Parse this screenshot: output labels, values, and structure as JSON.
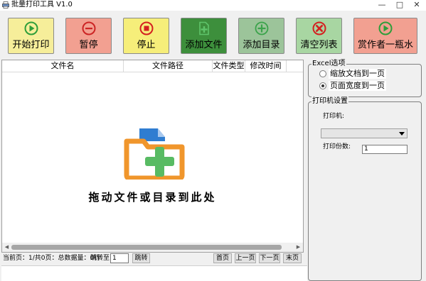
{
  "window": {
    "title": "批量打印工具 V1.0",
    "minimize_glyph": "—",
    "maximize_glyph": "□",
    "close_glyph": "✕"
  },
  "toolbar": {
    "buttons": [
      {
        "id": "start",
        "label": "开始打印",
        "icon": "play-circle-icon",
        "bg": "#f6ee9a",
        "icon_color": "#2e9e3a"
      },
      {
        "id": "pause",
        "label": "暂停",
        "icon": "minus-circle-icon",
        "bg": "#f2a091",
        "icon_color": "#cc2424"
      },
      {
        "id": "stop",
        "label": "停止",
        "icon": "stop-circle-icon",
        "bg": "#f6ee7a",
        "icon_color": "#d42020"
      },
      {
        "id": "addfile",
        "label": "添加文件",
        "icon": "add-file-icon",
        "bg": "#3d8f3c",
        "icon_color": "#5fc46a"
      },
      {
        "id": "adddir",
        "label": "添加目录",
        "icon": "add-folder-icon",
        "bg": "#9cc49a",
        "icon_color": "#3aa34a"
      },
      {
        "id": "clear",
        "label": "清空列表",
        "icon": "clear-x-icon",
        "bg": "#a8d6a2",
        "icon_color": "#d42020"
      },
      {
        "id": "donate",
        "label": "赏作者一瓶水",
        "icon": "donate-play-icon",
        "bg": "#f2a091",
        "icon_color": "#2e9e3a"
      }
    ]
  },
  "file_list": {
    "columns": [
      "文件名",
      "文件路径",
      "文件类型",
      "修改时间"
    ],
    "drop_hint": "拖动文件或目录到此处"
  },
  "pager": {
    "status": "当前页：1/共0页：总数据量：0行",
    "jump_label": "跳转至",
    "jump_value": "1",
    "jump_button": "跳转",
    "first": "首页",
    "prev": "上一页",
    "next": "下一页",
    "last": "末页"
  },
  "excel_options": {
    "title": "Excel选项",
    "option_fit_doc": "缩放文档到一页",
    "option_fit_width": "页面宽度到一页",
    "selected": "页面宽度到一页"
  },
  "printer_settings": {
    "title": "打印机设置",
    "printer_label": "打印机:",
    "printer_value": "",
    "copies_label": "打印份数:",
    "copies_value": "1"
  }
}
